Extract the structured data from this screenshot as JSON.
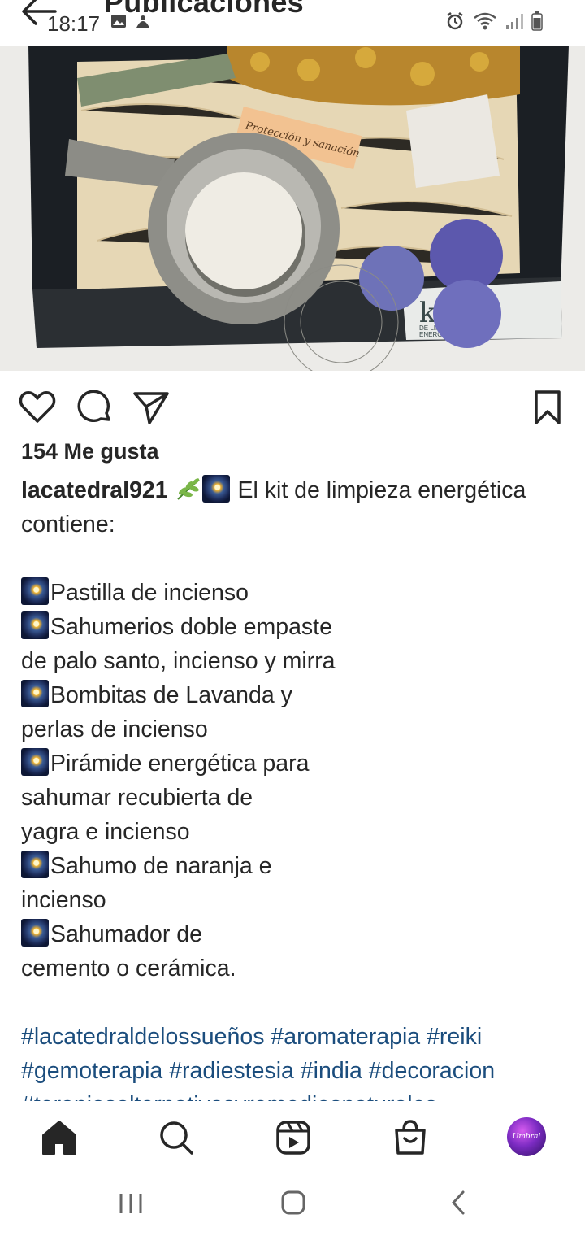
{
  "status_bar": {
    "time": "18:17"
  },
  "header": {
    "title": "Publicaciones"
  },
  "post": {
    "image_text": {
      "label": "Protección y sanación",
      "kit": "kit",
      "kit_sub1": "DE LIMPIEZA",
      "kit_sub2": "ENERGÉTICA"
    },
    "likes": "154 Me gusta",
    "username": "lacatedral921",
    "caption_intro_1": " El kit de limpieza energética",
    "caption_intro_2": "contiene:",
    "items": [
      [
        "Pastilla de incienso"
      ],
      [
        "Sahumerios doble empaste",
        "de palo santo, incienso y mirra"
      ],
      [
        "Bombitas de Lavanda y",
        "perlas de incienso"
      ],
      [
        "Pirámide energética para",
        "sahumar recubierta de",
        "yagra e incienso"
      ],
      [
        "Sahumo de naranja e",
        "incienso"
      ],
      [
        "Sahumador de",
        "cemento o cerámica."
      ]
    ],
    "hashtags": [
      "#lacatedraldelossueños #aromaterapia #reiki",
      "#gemoterapia #radiestesia #india #decoracion",
      "#terapiasalternativasyremediosnaturales"
    ]
  },
  "bottom_nav": {
    "avatar_text": "Umbral"
  },
  "icons": {
    "back": "back-arrow-icon",
    "like": "heart-icon",
    "comment": "comment-icon",
    "share": "send-icon",
    "save": "bookmark-icon",
    "home": "home-icon",
    "search": "search-icon",
    "reels": "reels-icon",
    "shop": "shop-icon"
  }
}
